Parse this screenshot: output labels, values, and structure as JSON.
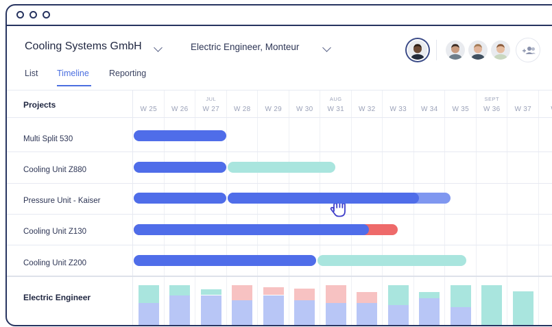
{
  "window": {
    "controls": [
      "close",
      "minimize",
      "maximize"
    ]
  },
  "header": {
    "company": "Cooling Systems GmbH",
    "role_filter": "Electric Engineer,  Monteur",
    "avatars": [
      {
        "name": "avatar-selected",
        "skin": "#6b4a36",
        "hair": "#2a1c14",
        "shirt": "#222a3a"
      },
      {
        "name": "avatar-2",
        "skin": "#c99b7e",
        "hair": "#3a2a22",
        "shirt": "#6e7e8a"
      },
      {
        "name": "avatar-3",
        "skin": "#e0b49a",
        "hair": "#a37a55",
        "shirt": "#405060"
      },
      {
        "name": "avatar-4",
        "skin": "#e6bda0",
        "hair": "#8a5a3a",
        "shirt": "#c9d7c0"
      }
    ]
  },
  "tabs": [
    {
      "label": "List",
      "active": false
    },
    {
      "label": "Timeline",
      "active": true
    },
    {
      "label": "Reporting",
      "active": false
    }
  ],
  "timeline": {
    "column_header": "Projects",
    "weeks": [
      "W 25",
      "W 26",
      "W 27",
      "W 28",
      "W 29",
      "W 30",
      "W 31",
      "W 32",
      "W 33",
      "W 34",
      "W 35",
      "W 36",
      "W 37",
      "W"
    ],
    "months": [
      {
        "label": "JUL",
        "week_index": 2
      },
      {
        "label": "AUG",
        "week_index": 6
      },
      {
        "label": "SEPT",
        "week_index": 11
      }
    ],
    "projects": [
      {
        "name": "Multi Split 530",
        "bars": [
          {
            "start": 0,
            "end": 3,
            "style": "blue"
          }
        ]
      },
      {
        "name": "Cooling Unit Z880",
        "bars": [
          {
            "start": 0,
            "end": 3,
            "style": "blue"
          },
          {
            "start": 3,
            "end": 6.5,
            "style": "teal"
          }
        ]
      },
      {
        "name": "Pressure Unit - Kaiser",
        "bars": [
          {
            "start": 0,
            "end": 3,
            "style": "blue"
          },
          {
            "start": 3,
            "end": 9,
            "style": "blue",
            "overflow_end": 9,
            "tail_style": "lightblue",
            "tail_end": 10.2
          }
        ]
      },
      {
        "name": "Cooling Unit Z130",
        "bars": [
          {
            "start": 0,
            "end": 7.4,
            "style": "blue",
            "tail_style": "red",
            "tail_end": 8.5
          }
        ]
      },
      {
        "name": "Cooling Unit Z200",
        "bars": [
          {
            "start": 0,
            "end": 5.9,
            "style": "blue"
          },
          {
            "start": 5.9,
            "end": 10.7,
            "style": "teal"
          }
        ]
      }
    ],
    "resource_row": {
      "label": "Electric Engineer",
      "capacity": [
        {
          "allocated": 0.55,
          "free": 0.45,
          "over": 0
        },
        {
          "allocated": 0.75,
          "free": 0.25,
          "over": 0
        },
        {
          "allocated": 0.75,
          "free": 0.15,
          "over": 0
        },
        {
          "allocated": 0.62,
          "free": 0,
          "over": 0.38
        },
        {
          "allocated": 0.75,
          "free": 0,
          "over": 0.2
        },
        {
          "allocated": 0.62,
          "free": 0,
          "over": 0.3
        },
        {
          "allocated": 0.55,
          "free": 0,
          "over": 0.45
        },
        {
          "allocated": 0.55,
          "free": 0,
          "over": 0.28
        },
        {
          "allocated": 0.5,
          "free": 0.5,
          "over": 0
        },
        {
          "allocated": 0.68,
          "free": 0.15,
          "over": 0
        },
        {
          "allocated": 0.45,
          "free": 0.55,
          "over": 0
        },
        {
          "allocated": 0,
          "free": 1.0,
          "over": 0
        },
        {
          "allocated": 0,
          "free": 0.85,
          "over": 0
        }
      ]
    }
  },
  "colors": {
    "accent": "#4a6ee0",
    "bar_blue": "#4f6de9",
    "bar_teal": "#a9e5de",
    "bar_lightblue": "#7f97f0",
    "bar_red": "#ee6a6a",
    "cap_allocated": "#b8c6f6",
    "cap_free": "#a9e5de",
    "cap_over": "#f7c2c2",
    "frame": "#26335f"
  }
}
